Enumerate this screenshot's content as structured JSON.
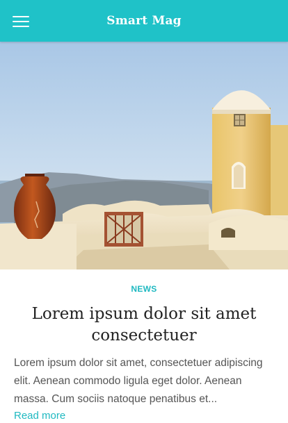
{
  "header": {
    "brand": "Smart Mag",
    "menu_icon": "hamburger-menu-icon",
    "background_color": "#1fc2c8"
  },
  "article": {
    "category": "NEWS",
    "title": "Lorem ipsum dolor sit amet consectetuer",
    "excerpt": "Lorem ipsum dolor sit amet, consectetuer adipiscing elit. Aenean commodo ligula eget dolor. Aenean massa. Cum sociis natoque penatibus et...",
    "read_more": "Read more",
    "accent_color": "#1fb9c1"
  }
}
